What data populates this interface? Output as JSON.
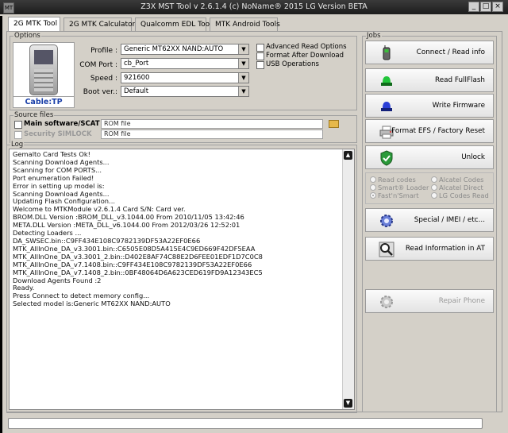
{
  "window": {
    "title": "Z3X MST Tool v 2.6.1.4 (c) NoName® 2015 LG Version BETA",
    "app_icon_text": "MT",
    "minimize_label": "_",
    "maximize_label": "□",
    "close_label": "×"
  },
  "tabs": [
    {
      "label": "2G MTK Tool",
      "active": true
    },
    {
      "label": "2G MTK Calculator"
    },
    {
      "label": "Qualcomm EDL Tool"
    },
    {
      "label": "MTK Android Tools"
    }
  ],
  "options": {
    "title": "Options",
    "cable_label": "Cable:TP",
    "profile_label": "Profile :",
    "profile_value": "Generic MT62XX NAND:AUTO",
    "comport_label": "COM Port :",
    "comport_value": "cb_Port",
    "speed_label": "Speed :",
    "speed_value": "921600",
    "bootver_label": "Boot ver.:",
    "bootver_value": "Default",
    "advanced_read": "Advanced Read Options",
    "format_after": "Format After Download",
    "usb_ops": "USB Operations"
  },
  "source": {
    "title": "Source files",
    "main_label": "Main software/SCAT",
    "main_value": "ROM file",
    "security_label": "Security SIMLOCK",
    "security_value": "ROM file"
  },
  "log": {
    "title": "Log",
    "lines": [
      "Gemalto Card Tests Ok!",
      "Scanning Download Agents...",
      "Scanning for COM PORTS...",
      "Port enumeration Failed!",
      "Error in setting up model is:",
      "Scanning Download Agents...",
      "Updating Flash Configuration...",
      "Welcome to MTKModule v2.6.1.4 Card S/N: Card ver.",
      "BROM.DLL Version :BROM_DLL_v3.1044.00 From 2010/11/05 13:42:46",
      "META.DLL Version :META_DLL_v6.1044.00 From 2012/03/26 12:52:01",
      "Detecting Loaders ...",
      "DA_SWSEC.bin::C9FF434E108C9782139DF53A22EF0E66",
      "MTK_AllInOne_DA_v3.3001.bin::C6505E08D5A415E4C9ED669F42DF5EAA",
      "MTK_AllInOne_DA_v3.3001_2.bin::D402E8AF74C88E2D6FEE01EDF1D7C0C8",
      "MTK_AllInOne_DA_v7.1408.bin::C9FF434E108C9782139DF53A22EF0E66",
      "MTK_AllInOne_DA_v7.1408_2.bin::0BF48064D6A623CED619FD9A12343EC5",
      "Download Agents Found :2",
      "Ready.",
      "Press Connect to detect memory config...",
      "Selected model is:Generic MT62XX NAND:AUTO"
    ]
  },
  "jobs": {
    "title": "Jobs",
    "connect": "Connect / Read info",
    "read_fullflash": "Read FullFlash",
    "write_firmware": "Write Firmware",
    "format_efs": "Format EFS / Factory Reset",
    "unlock": "Unlock",
    "read_codes": "Read codes",
    "smart_loader": "Smart® Loader",
    "fastn_smart": "Fast'n'Smart",
    "alcatel_codes": "Alcatel Codes",
    "alcatel_direct": "Alcatel Direct",
    "lg_codes_read": "LG Codes Read",
    "special_imei": "Special / IMEI / etc...",
    "read_info_at": "Read Information in AT",
    "repair_phone": "Repair Phone"
  },
  "colors": {
    "accent_blue": "#1a3fa8",
    "green_light": "#22c53a",
    "blue_light": "#2a3fd8"
  },
  "icons": {
    "connect": "phone-icon",
    "read": "green-light-icon",
    "write": "blue-light-icon",
    "format": "printer-icon",
    "unlock": "shield-check-icon",
    "special": "gear-icon",
    "read_at": "magnifier-icon",
    "repair": "gear-icon"
  }
}
